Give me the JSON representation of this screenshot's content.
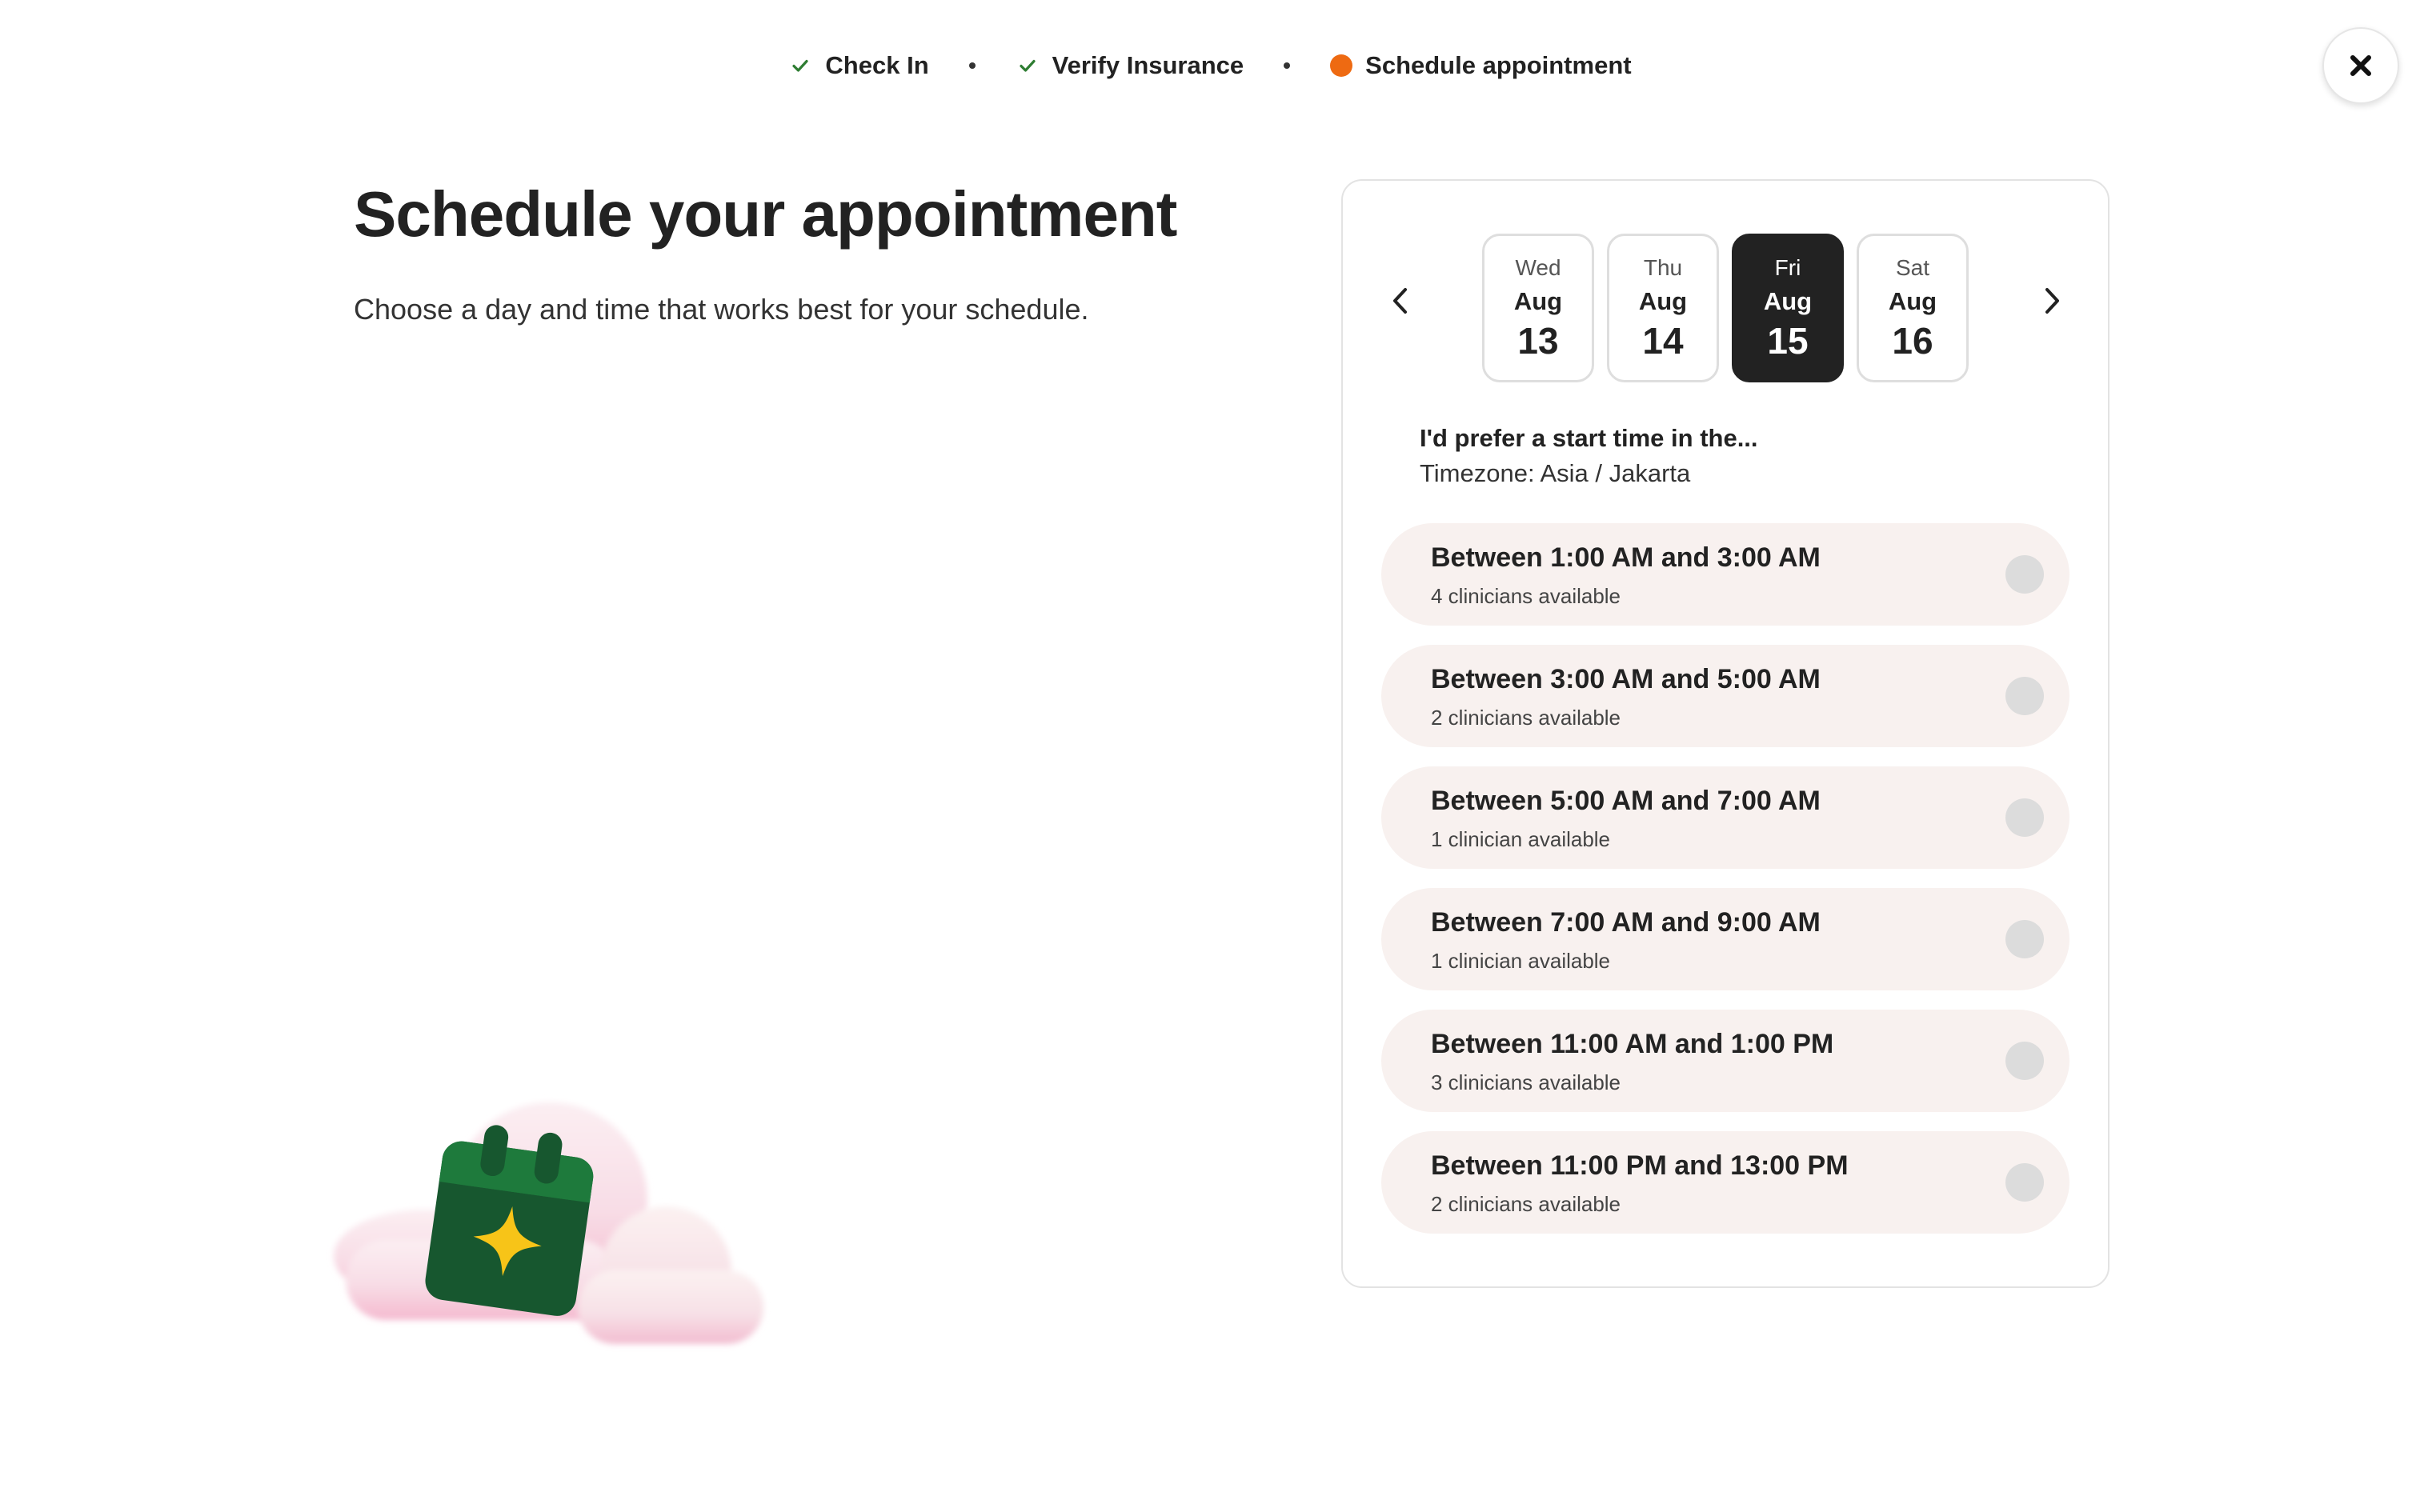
{
  "progress": {
    "steps": [
      {
        "label": "Check In",
        "status": "done"
      },
      {
        "label": "Verify Insurance",
        "status": "done"
      },
      {
        "label": "Schedule appointment",
        "status": "current"
      }
    ],
    "done_color": "#2e7d32",
    "current_color": "#ee6a12"
  },
  "close_icon": "close-icon",
  "header": {
    "title": "Schedule your appointment",
    "subtitle": "Choose a day and time that works best for your schedule."
  },
  "date_picker": {
    "prev_icon": "chevron-left-icon",
    "next_icon": "chevron-right-icon",
    "days": [
      {
        "dow": "Wed",
        "month": "Aug",
        "day": "13",
        "selected": false
      },
      {
        "dow": "Thu",
        "month": "Aug",
        "day": "14",
        "selected": false
      },
      {
        "dow": "Fri",
        "month": "Aug",
        "day": "15",
        "selected": true
      },
      {
        "dow": "Sat",
        "month": "Aug",
        "day": "16",
        "selected": false
      }
    ]
  },
  "preference": {
    "title": "I'd prefer a start time in the...",
    "timezone": "Timezone: Asia / Jakarta"
  },
  "slots": [
    {
      "label": "Between 1:00 AM and 3:00 AM",
      "availability": "4 clinicians available"
    },
    {
      "label": "Between 3:00 AM and 5:00 AM",
      "availability": "2 clinicians available"
    },
    {
      "label": "Between 5:00 AM and 7:00 AM",
      "availability": "1 clinician available"
    },
    {
      "label": "Between 7:00 AM and 9:00 AM",
      "availability": "1 clinician available"
    },
    {
      "label": "Between 11:00 AM and 1:00 PM",
      "availability": "3 clinicians available"
    },
    {
      "label": "Between 11:00 PM and 13:00 PM",
      "availability": "2 clinicians available"
    }
  ],
  "illustration_icon": "calendar-sparkle-icon"
}
